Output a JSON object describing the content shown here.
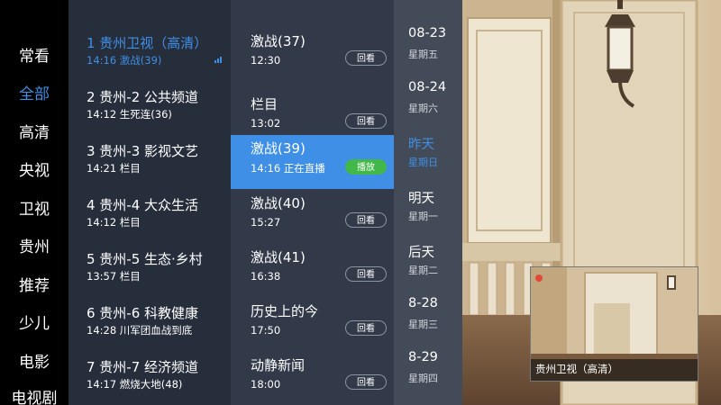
{
  "categories": [
    {
      "label": "常看",
      "active": false
    },
    {
      "label": "全部",
      "active": true
    },
    {
      "label": "高清",
      "active": false
    },
    {
      "label": "央视",
      "active": false
    },
    {
      "label": "卫视",
      "active": false
    },
    {
      "label": "贵州",
      "active": false
    },
    {
      "label": "推荐",
      "active": false
    },
    {
      "label": "少儿",
      "active": false
    },
    {
      "label": "电影",
      "active": false
    },
    {
      "label": "电视剧",
      "active": false
    }
  ],
  "channels": [
    {
      "name": "1 贵州卫视（高清）",
      "program": "14:16 激战(39)",
      "active": true
    },
    {
      "name": "2 贵州-2 公共频道",
      "program": "14:12 生死连(36)",
      "active": false
    },
    {
      "name": "3 贵州-3 影视文艺",
      "program": "14:21 栏目",
      "active": false
    },
    {
      "name": "4 贵州-4 大众生活",
      "program": "14:12 栏目",
      "active": false
    },
    {
      "name": "5 贵州-5 生态·乡村",
      "program": "13:57 栏目",
      "active": false
    },
    {
      "name": "6 贵州-6 科教健康",
      "program": "14:28 川军团血战到底",
      "active": false
    },
    {
      "name": "7 贵州-7 经济频道",
      "program": "14:17 燃烧大地(48)",
      "active": false
    }
  ],
  "programs": [
    {
      "title": "激战(37)",
      "time": "12:30",
      "button": "回看",
      "active": false
    },
    {
      "title": "栏目",
      "time": "13:02",
      "button": "回看",
      "active": false
    },
    {
      "title": "激战(39)",
      "time": "14:16 正在直播",
      "button": "播放",
      "active": true
    },
    {
      "title": "激战(40)",
      "time": "15:27",
      "button": "回看",
      "active": false
    },
    {
      "title": "激战(41)",
      "time": "16:38",
      "button": "回看",
      "active": false
    },
    {
      "title": "历史上的今",
      "time": "17:50",
      "button": "回看",
      "active": false
    },
    {
      "title": "动静新闻",
      "time": "18:00",
      "button": "回看",
      "active": false
    }
  ],
  "dates": [
    {
      "date": "08-23",
      "weekday": "星期五",
      "active": false
    },
    {
      "date": "08-24",
      "weekday": "星期六",
      "active": false
    },
    {
      "date": "昨天",
      "weekday": "星期日",
      "active": true
    },
    {
      "date": "明天",
      "weekday": "星期一",
      "active": false
    },
    {
      "date": "后天",
      "weekday": "星期二",
      "active": false
    },
    {
      "date": "8-28",
      "weekday": "星期三",
      "active": false
    },
    {
      "date": "8-29",
      "weekday": "星期四",
      "active": false
    }
  ],
  "pip": {
    "label": "贵州卫视（高清）"
  },
  "colors": {
    "accent": "#3f8fe6",
    "play_button": "#43b84a"
  }
}
